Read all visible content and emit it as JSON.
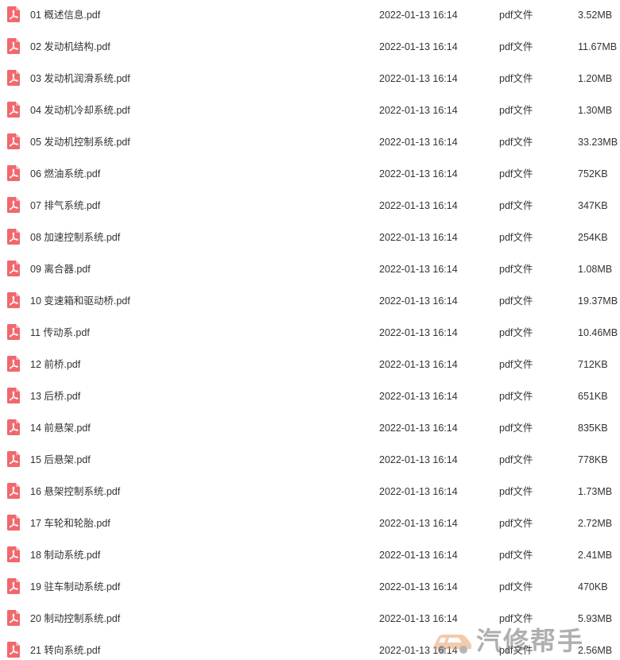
{
  "files": [
    {
      "name": "01 概述信息.pdf",
      "date": "2022-01-13 16:14",
      "type": "pdf文件",
      "size": "3.52MB"
    },
    {
      "name": "02 发动机结构.pdf",
      "date": "2022-01-13 16:14",
      "type": "pdf文件",
      "size": "11.67MB"
    },
    {
      "name": "03 发动机润滑系统.pdf",
      "date": "2022-01-13 16:14",
      "type": "pdf文件",
      "size": "1.20MB"
    },
    {
      "name": "04 发动机冷却系统.pdf",
      "date": "2022-01-13 16:14",
      "type": "pdf文件",
      "size": "1.30MB"
    },
    {
      "name": "05 发动机控制系统.pdf",
      "date": "2022-01-13 16:14",
      "type": "pdf文件",
      "size": "33.23MB"
    },
    {
      "name": "06 燃油系统.pdf",
      "date": "2022-01-13 16:14",
      "type": "pdf文件",
      "size": "752KB"
    },
    {
      "name": "07 排气系统.pdf",
      "date": "2022-01-13 16:14",
      "type": "pdf文件",
      "size": "347KB"
    },
    {
      "name": "08 加速控制系统.pdf",
      "date": "2022-01-13 16:14",
      "type": "pdf文件",
      "size": "254KB"
    },
    {
      "name": "09 离合器.pdf",
      "date": "2022-01-13 16:14",
      "type": "pdf文件",
      "size": "1.08MB"
    },
    {
      "name": "10 变速箱和驱动桥.pdf",
      "date": "2022-01-13 16:14",
      "type": "pdf文件",
      "size": "19.37MB"
    },
    {
      "name": "11 传动系.pdf",
      "date": "2022-01-13 16:14",
      "type": "pdf文件",
      "size": "10.46MB"
    },
    {
      "name": "12 前桥.pdf",
      "date": "2022-01-13 16:14",
      "type": "pdf文件",
      "size": "712KB"
    },
    {
      "name": "13 后桥.pdf",
      "date": "2022-01-13 16:14",
      "type": "pdf文件",
      "size": "651KB"
    },
    {
      "name": "14 前悬架.pdf",
      "date": "2022-01-13 16:14",
      "type": "pdf文件",
      "size": "835KB"
    },
    {
      "name": "15 后悬架.pdf",
      "date": "2022-01-13 16:14",
      "type": "pdf文件",
      "size": "778KB"
    },
    {
      "name": "16 悬架控制系统.pdf",
      "date": "2022-01-13 16:14",
      "type": "pdf文件",
      "size": "1.73MB"
    },
    {
      "name": "17 车轮和轮胎.pdf",
      "date": "2022-01-13 16:14",
      "type": "pdf文件",
      "size": "2.72MB"
    },
    {
      "name": "18 制动系统.pdf",
      "date": "2022-01-13 16:14",
      "type": "pdf文件",
      "size": "2.41MB"
    },
    {
      "name": "19 驻车制动系统.pdf",
      "date": "2022-01-13 16:14",
      "type": "pdf文件",
      "size": "470KB"
    },
    {
      "name": "20 制动控制系统.pdf",
      "date": "2022-01-13 16:14",
      "type": "pdf文件",
      "size": "5.93MB"
    },
    {
      "name": "21 转向系统.pdf",
      "date": "2022-01-13 16:14",
      "type": "pdf文件",
      "size": "2.56MB"
    }
  ],
  "icons": {
    "file_icon": "pdf-file-icon",
    "file_icon_color": "#f0686d"
  },
  "watermark": {
    "text": "汽修帮手",
    "logo": "car-logo-icon"
  }
}
